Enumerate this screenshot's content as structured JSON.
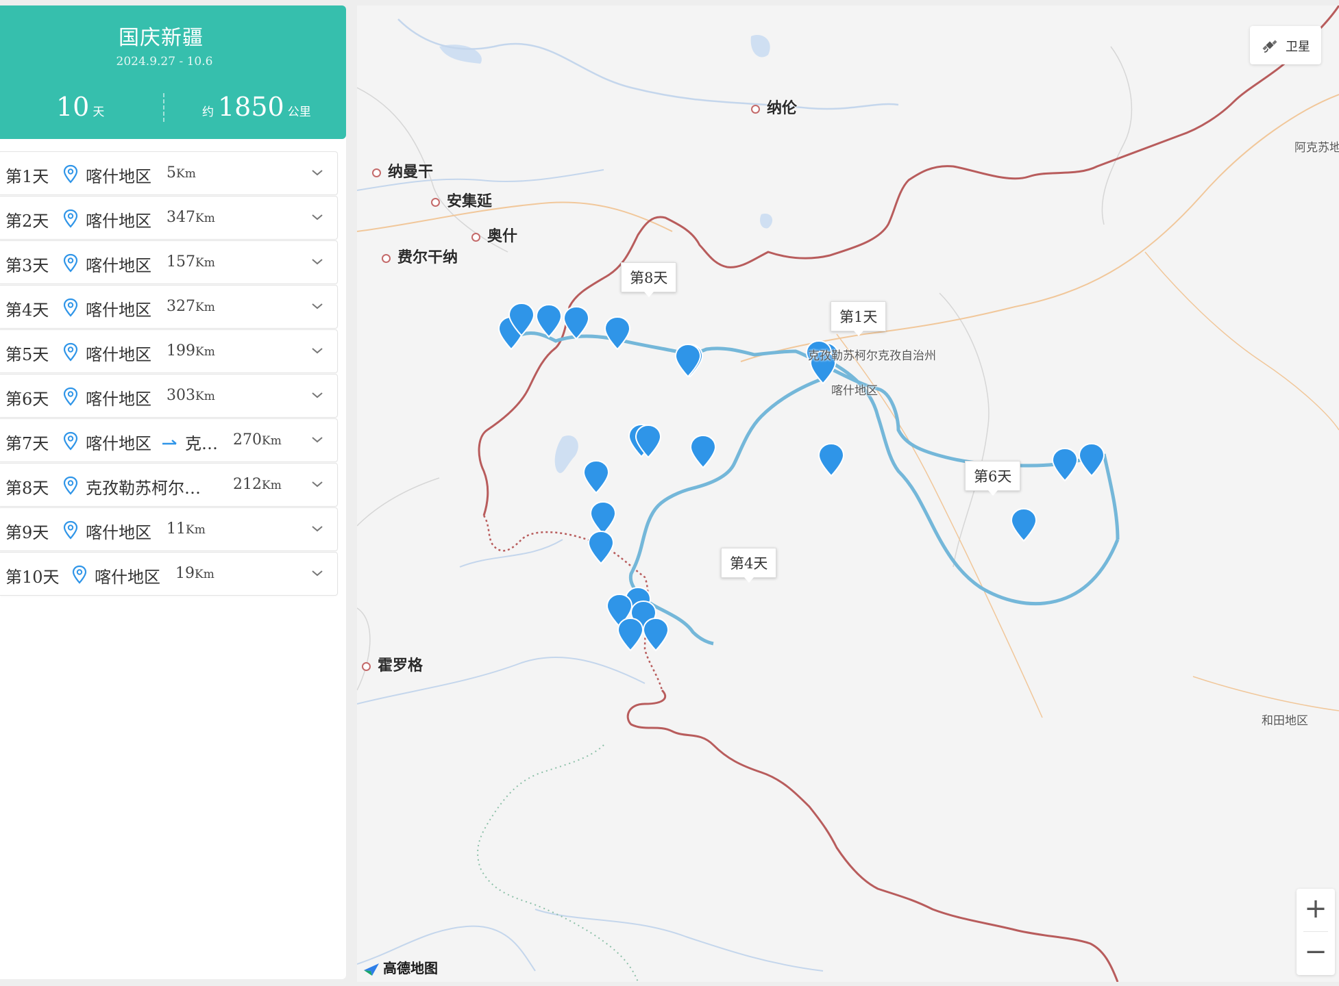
{
  "trip": {
    "title": "国庆新疆",
    "dates": "2024.9.27 - 10.6",
    "days_value": "10",
    "days_unit": "天",
    "distance_prefix": "约",
    "distance_value": "1850",
    "distance_unit": "公里"
  },
  "days": [
    {
      "label": "第1天",
      "location": "喀什地区",
      "distance": "5",
      "unit": "Km"
    },
    {
      "label": "第2天",
      "location": "喀什地区",
      "distance": "347",
      "unit": "Km"
    },
    {
      "label": "第3天",
      "location": "喀什地区",
      "distance": "157",
      "unit": "Km"
    },
    {
      "label": "第4天",
      "location": "喀什地区",
      "distance": "327",
      "unit": "Km"
    },
    {
      "label": "第5天",
      "location": "喀什地区",
      "distance": "199",
      "unit": "Km"
    },
    {
      "label": "第6天",
      "location": "喀什地区",
      "distance": "303",
      "unit": "Km"
    },
    {
      "label": "第7天",
      "location": "喀什地区",
      "to": "克…",
      "distance": "270",
      "unit": "Km"
    },
    {
      "label": "第8天",
      "location": "克孜勒苏柯尔…",
      "distance": "212",
      "unit": "Km"
    },
    {
      "label": "第9天",
      "location": "喀什地区",
      "distance": "11",
      "unit": "Km"
    },
    {
      "label": "第10天",
      "location": "喀什地区",
      "distance": "19",
      "unit": "Km"
    }
  ],
  "map": {
    "satellite_label": "卫星",
    "zoom_in": "+",
    "zoom_out": "−",
    "provider": "高德地图",
    "cities": [
      "纳伦",
      "纳曼干",
      "安集延",
      "奥什",
      "费尔干纳",
      "霍罗格"
    ],
    "regions": [
      "阿克苏地",
      "和田地区",
      "克孜勒苏柯尔克孜自治州",
      "喀什地区"
    ],
    "day_markers": [
      "第8天",
      "第1天",
      "第6天",
      "第4天"
    ]
  },
  "colors": {
    "accent": "#36bfad",
    "pin": "#2f95e8",
    "route": "#74b7d9",
    "border": "#b85c5c"
  }
}
